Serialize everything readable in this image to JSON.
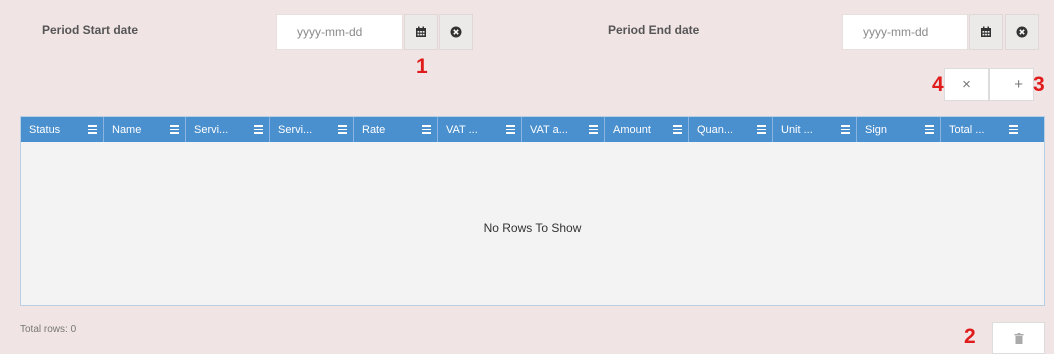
{
  "filters": {
    "start_label": "Period Start date",
    "end_label": "Period End date",
    "start_placeholder": "yyyy-mm-dd",
    "end_placeholder": "yyyy-mm-dd"
  },
  "markers": {
    "m1": "1",
    "m2": "2",
    "m3": "3",
    "m4": "4"
  },
  "toolbar": {
    "clear_label": "×",
    "add_label": "+"
  },
  "grid": {
    "columns": [
      "Status",
      "Name",
      "Servi...",
      "Servi...",
      "Rate",
      "VAT ...",
      "VAT a...",
      "Amount",
      "Quan...",
      "Unit ...",
      "Sign",
      "Total ..."
    ],
    "empty_message": "No Rows To Show"
  },
  "footer": {
    "total_rows": "Total rows: 0"
  },
  "colors": {
    "page_background": "#f1e4e4",
    "grid_header": "#4a8fce",
    "marker": "#e01b1b"
  }
}
